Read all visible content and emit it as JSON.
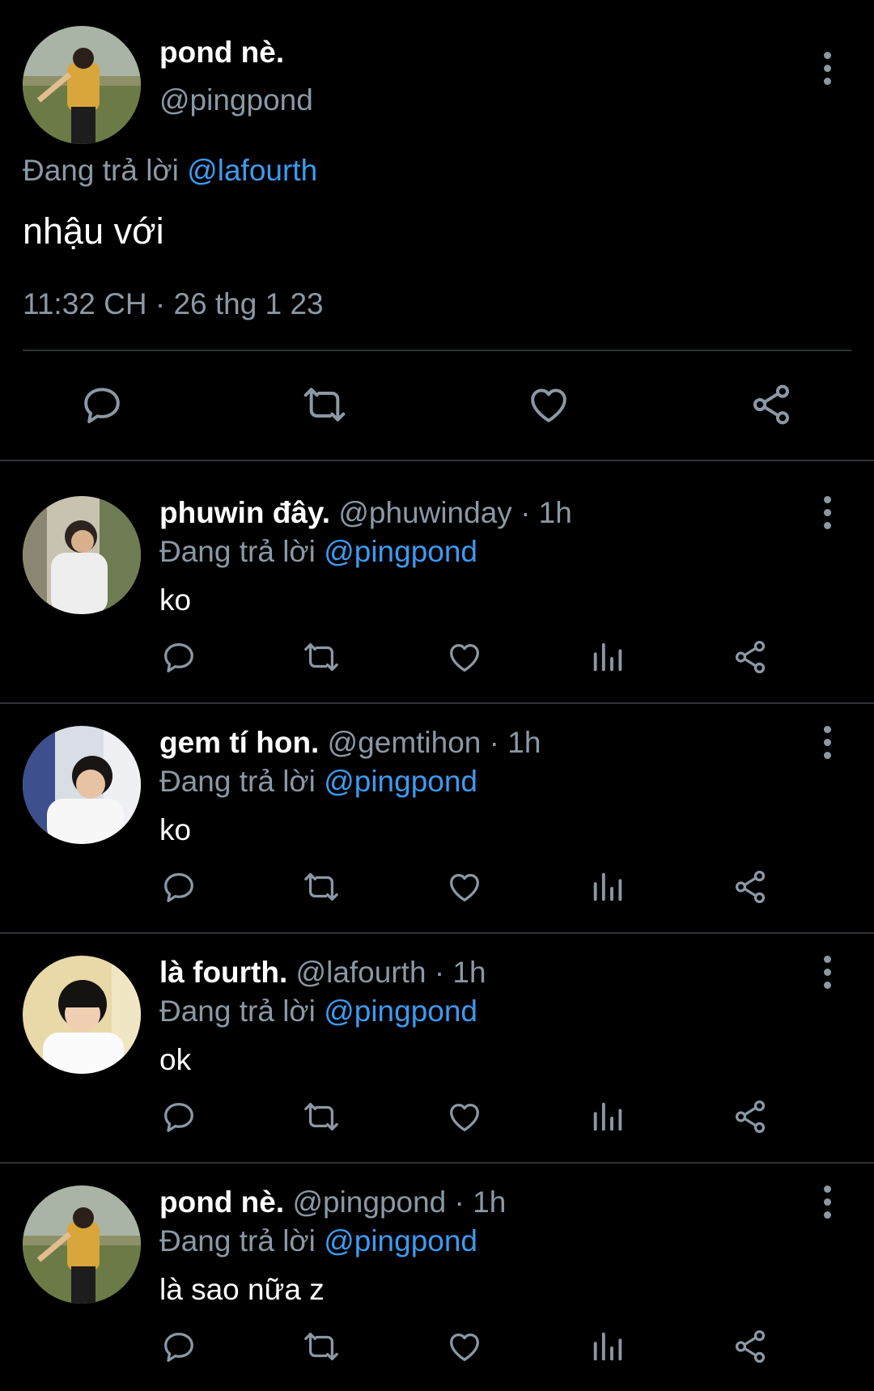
{
  "main_tweet": {
    "name": "pond nè.",
    "handle": "@pingpond",
    "replying_prefix": "Đang trả lời",
    "replying_to": "@lafourth",
    "text": "nhậu với",
    "timestamp": "11:32 CH · 26 thg 1 23",
    "actions": [
      "reply-icon",
      "retweet-icon",
      "like-icon",
      "share-icon"
    ]
  },
  "replies": [
    {
      "name": "phuwin đây.",
      "handle": "@phuwinday",
      "time": "· 1h",
      "replying_prefix": "Đang trả lời",
      "replying_to": "@pingpond",
      "text": "ko"
    },
    {
      "name": "gem tí hon.",
      "handle": "@gemtihon",
      "time": "· 1h",
      "replying_prefix": "Đang trả lời",
      "replying_to": "@pingpond",
      "text": "ko"
    },
    {
      "name": "là fourth.",
      "handle": "@lafourth",
      "time": "· 1h",
      "replying_prefix": "Đang trả lời",
      "replying_to": "@pingpond",
      "text": "ok"
    },
    {
      "name": "pond nè.",
      "handle": "@pingpond",
      "time": "· 1h",
      "replying_prefix": "Đang trả lời",
      "replying_to": "@pingpond",
      "text": "là sao nữa z"
    }
  ],
  "colors": {
    "background": "#000000",
    "muted": "#8b98a5",
    "link": "#3e9af0",
    "divider": "#2f3336"
  }
}
